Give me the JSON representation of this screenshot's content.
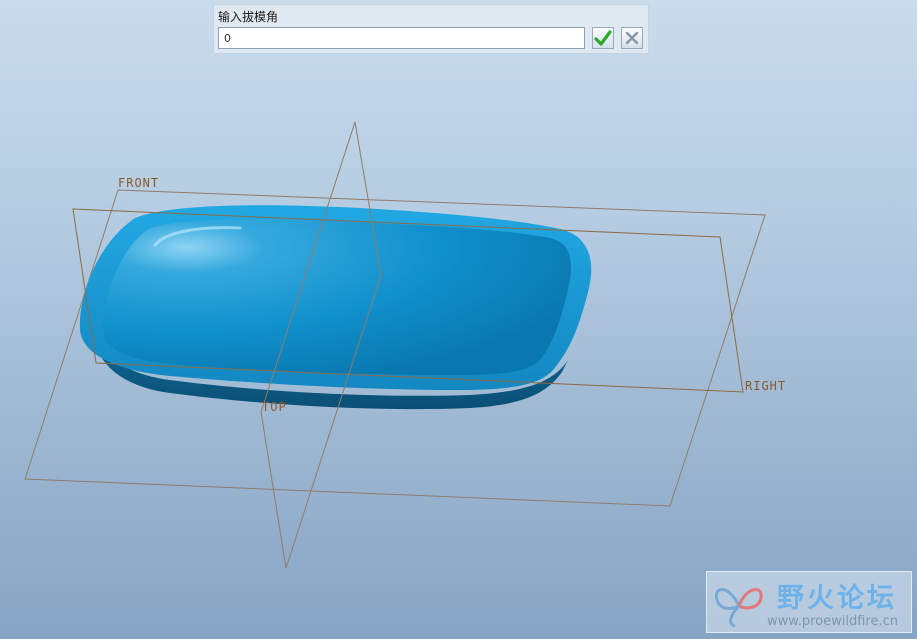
{
  "dialog": {
    "title": "输入拔模角",
    "input_value": "0",
    "confirm_icon": "checkmark-icon",
    "cancel_icon": "close-icon"
  },
  "datum_planes": {
    "front": "FRONT",
    "top": "TOP",
    "right": "RIGHT"
  },
  "watermark": {
    "name": "野火论坛",
    "url": "www.proewildfire.cn"
  },
  "colors": {
    "model_main": "#1596d3",
    "model_shadow": "#0e5f89",
    "datum_line": "#8a6a4a",
    "plane_label": "#8a5a2c",
    "confirm_green": "#2fa82a"
  }
}
